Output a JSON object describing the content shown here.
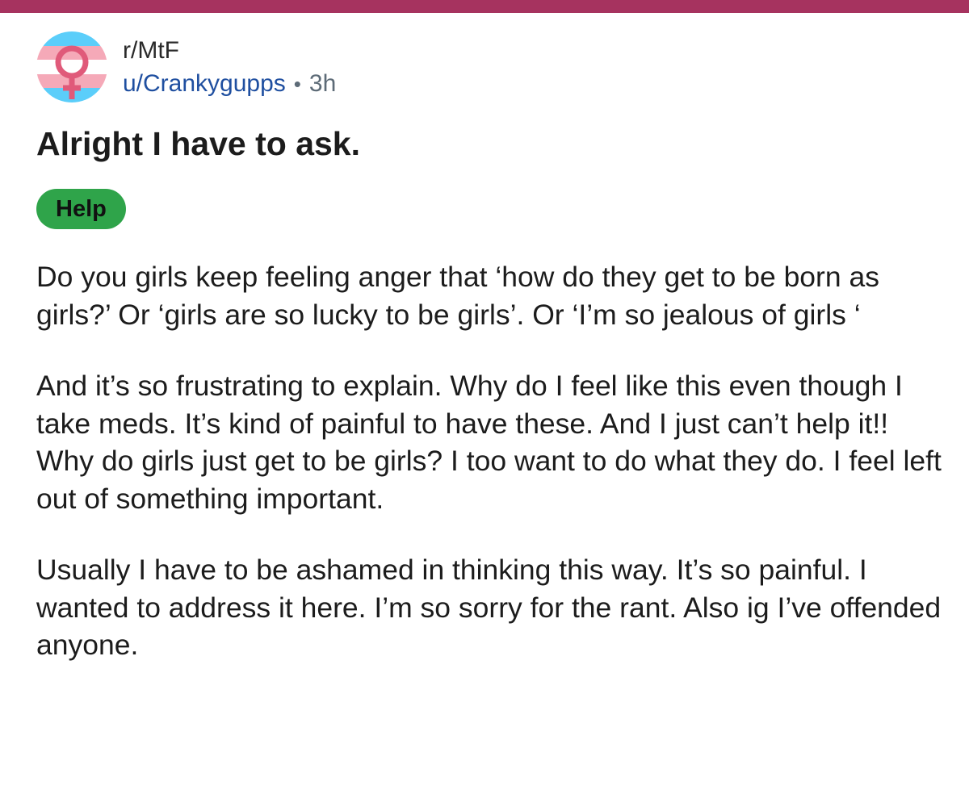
{
  "colors": {
    "top_bar": "#a6335f",
    "username": "#1f4fa0",
    "meta_gray": "#5d6b77",
    "flair_bg": "#2fa44a",
    "trans_blue": "#5bcefa",
    "trans_pink": "#f5a9b8",
    "trans_white": "#ffffff",
    "venus_symbol": "#e05a7a"
  },
  "post": {
    "subreddit": "r/MtF",
    "author": "u/Crankygupps",
    "separator": "•",
    "age": "3h",
    "avatar_icon": "trans-flag-venus-icon",
    "title": "Alright I have to ask.",
    "flair": "Help",
    "paragraphs": [
      "Do you girls keep feeling anger that ‘how do they get to be born as girls?’ Or ‘girls are so lucky to be girls’. Or  ‘I’m so jealous of girls ‘",
      "And it’s so frustrating to explain. Why do I feel like this even though I take meds. It’s kind of painful to have these. And I just can’t help it!! Why do girls just get to be girls? I too want to do what they do. I feel left out of something important.",
      "Usually I have to be ashamed in thinking this way. It’s so painful. I wanted to address it here. I’m so sorry for the rant. Also ig I’ve offended anyone."
    ]
  }
}
